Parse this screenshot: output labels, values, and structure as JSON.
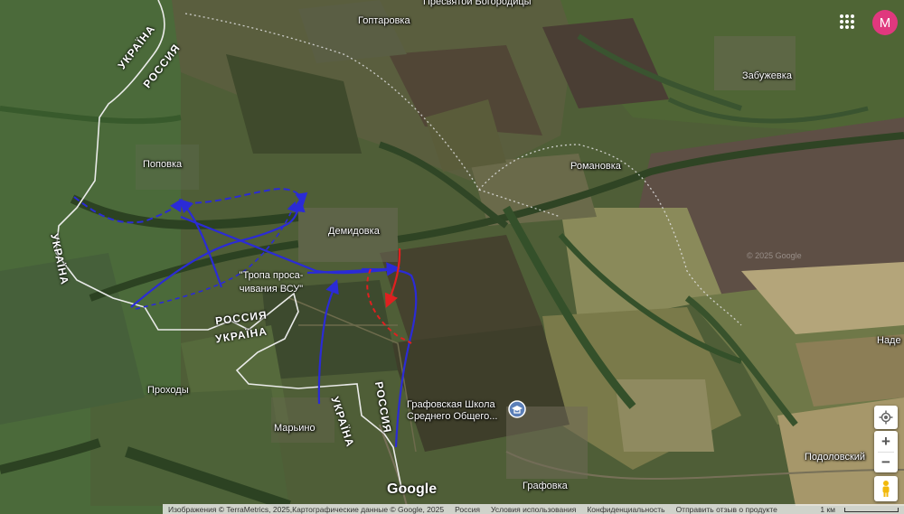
{
  "places": {
    "goptarovka": "Гоптаровка",
    "presvyatoy": "Пресвятой Богородицы",
    "zabuzhevka": "Забужевка",
    "popovka": "Поповка",
    "romanovka": "Романовка",
    "demidovka": "Демидовка",
    "prokhody": "Проходы",
    "maryino": "Марьино",
    "school": "Графовская Школа Среднего Общего...",
    "grafovka": "Графовка",
    "podolovsky": "Подоловский",
    "nade": "Наде"
  },
  "borders": {
    "ukraine_top": "УКРАЇНА",
    "russia_top": "РОССИЯ",
    "ukraine_left": "УКРАЇНА",
    "russia_mid": "РОССИЯ",
    "ukraine_mid": "УКРАЇНА",
    "ukraine_bottom": "УКРАЇНА",
    "russia_bottom": "РОССИЯ"
  },
  "annotation": {
    "line1": "\"Тропа проса-",
    "line2": "чивания ВСУ\""
  },
  "watermark": "© 2025 Google",
  "logo": "Google",
  "account_initial": "M",
  "controls": {
    "zoom_in": "+",
    "zoom_out": "−"
  },
  "footer": {
    "imagery": "Изображения © TerraMetrics, 2025,Картографические данные © Google, 2025",
    "country": "Россия",
    "terms": "Условия использования",
    "privacy": "Конфиденциальность",
    "feedback": "Отправить отзыв о продукте",
    "scale": "1 км"
  },
  "colors": {
    "blue_arrows": "#2b2bd6",
    "red_arrow": "#e02020",
    "border_line": "#f2f2f2",
    "avatar": "#e0387e"
  },
  "icons": [
    "apps-grid-icon",
    "locate-icon",
    "pegman-icon",
    "school-pin-icon"
  ]
}
